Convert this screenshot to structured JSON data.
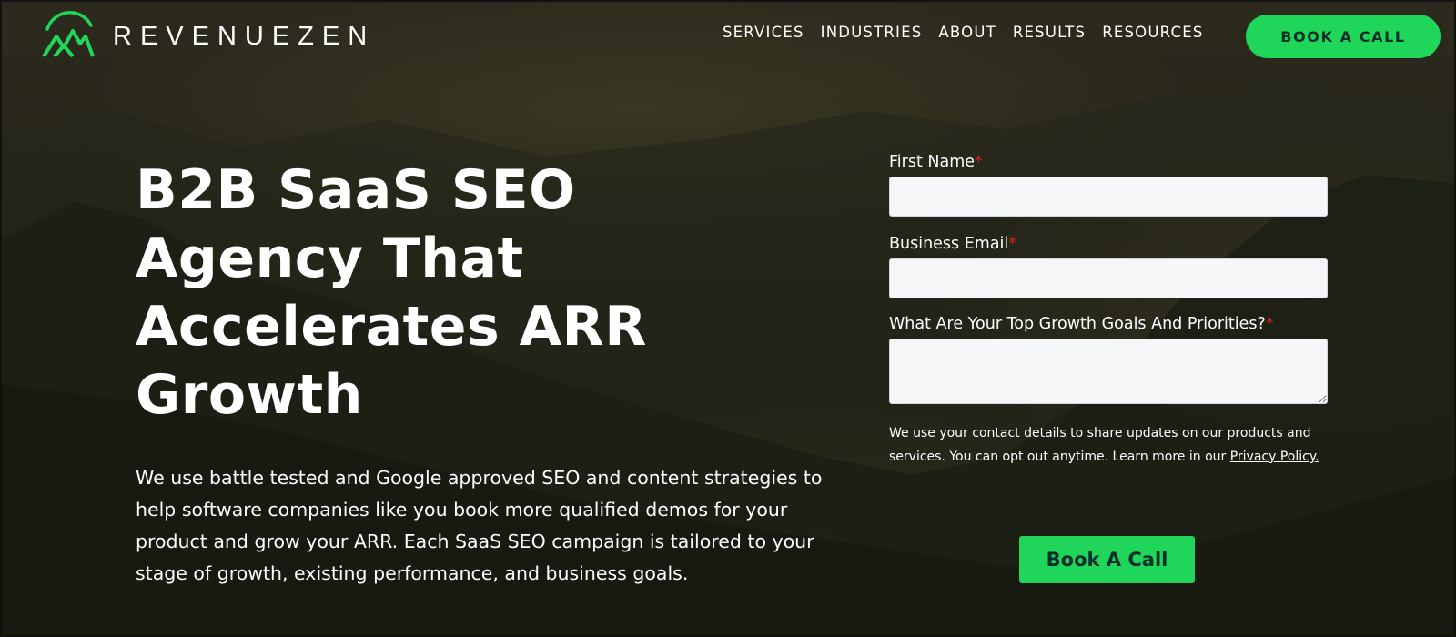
{
  "brand": {
    "name": "REVENUEZEN",
    "logo_icon": "mountain-logo-icon",
    "accent_color": "#1fd65a"
  },
  "nav": {
    "items": [
      {
        "label": "SERVICES"
      },
      {
        "label": "INDUSTRIES"
      },
      {
        "label": "ABOUT"
      },
      {
        "label": "RESULTS"
      },
      {
        "label": "RESOURCES"
      }
    ],
    "cta_label": "BOOK A CALL"
  },
  "hero": {
    "title": "B2B SaaS SEO Agency That Accelerates ARR Growth",
    "description": "We use battle tested and Google approved SEO and content strategies to help software companies like you book more qualified demos for your product and grow your ARR. Each SaaS SEO campaign is tailored to your stage of growth, existing performance, and business goals."
  },
  "form": {
    "fields": [
      {
        "label": "First Name",
        "required_mark": "*",
        "value": ""
      },
      {
        "label": "Business Email",
        "required_mark": "*",
        "value": ""
      },
      {
        "label": "What Are Your Top Growth Goals And Priorities?",
        "required_mark": "*",
        "value": ""
      }
    ],
    "privacy_text": "We use your contact details to share updates on our products and services. You can opt out anytime. Learn more in our ",
    "privacy_link": "Privacy Policy.",
    "submit_label": "Book A Call",
    "required_color": "#e0202a"
  }
}
